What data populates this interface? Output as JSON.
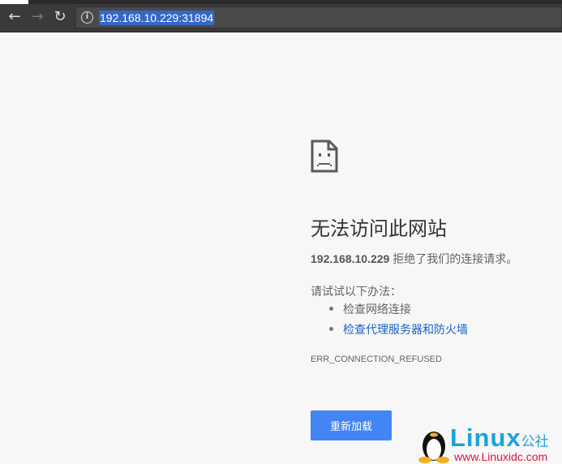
{
  "browser": {
    "url": "192.168.10.229:31894"
  },
  "error": {
    "title": "无法访问此网站",
    "host": "192.168.10.229",
    "message": " 拒绝了我们的连接请求。",
    "try_label": "请试试以下办法：",
    "suggestions": [
      "检查网络连接",
      "检查代理服务器和防火墙"
    ],
    "code": "ERR_CONNECTION_REFUSED",
    "reload_label": "重新加载"
  },
  "watermark": {
    "brand": "Linux",
    "brand_suffix": "公社",
    "site": "www.Linuxidc.com"
  }
}
